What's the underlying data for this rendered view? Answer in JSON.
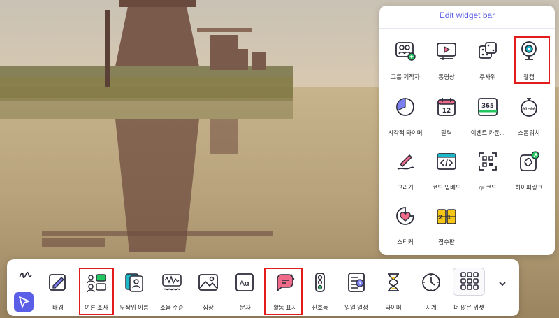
{
  "panel": {
    "title": "Edit widget bar",
    "items": [
      {
        "label": "그룹 제작자",
        "icon": "group-maker-icon"
      },
      {
        "label": "동영상",
        "icon": "video-icon"
      },
      {
        "label": "주사위",
        "icon": "dice-icon"
      },
      {
        "label": "웹캠",
        "icon": "webcam-icon"
      },
      {
        "label": "시각적 타이머",
        "icon": "visual-timer-icon"
      },
      {
        "label": "달력",
        "icon": "calendar-icon",
        "badge": "12"
      },
      {
        "label": "이벤트 카운...",
        "icon": "event-counter-icon",
        "badge": "365"
      },
      {
        "label": "스톱워치",
        "icon": "stopwatch-icon",
        "badge": "01:00"
      },
      {
        "label": "그리기",
        "icon": "draw-icon"
      },
      {
        "label": "코드 임베드",
        "icon": "code-embed-icon"
      },
      {
        "label": "qr 코드",
        "icon": "qr-code-icon"
      },
      {
        "label": "하이퍼링크",
        "icon": "hyperlink-icon"
      },
      {
        "label": "스티커",
        "icon": "sticker-icon"
      },
      {
        "label": "점수판",
        "icon": "scoreboard-icon",
        "badge": "21"
      }
    ]
  },
  "toolbar": {
    "tools": [
      {
        "label": "배경",
        "icon": "background-icon"
      },
      {
        "label": "여론 조사",
        "icon": "poll-icon"
      },
      {
        "label": "무작위 이름",
        "icon": "random-name-icon"
      },
      {
        "label": "소음 수준",
        "icon": "noise-level-icon"
      },
      {
        "label": "심상",
        "icon": "image-icon"
      },
      {
        "label": "문자",
        "icon": "text-icon",
        "glyph": "Aα"
      },
      {
        "label": "활동 표시",
        "icon": "activity-icon"
      },
      {
        "label": "신호등",
        "icon": "traffic-light-icon"
      },
      {
        "label": "일일 일정",
        "icon": "daily-schedule-icon"
      },
      {
        "label": "타이머",
        "icon": "hourglass-icon"
      },
      {
        "label": "시계",
        "icon": "clock-icon"
      },
      {
        "label": "더 많은 위젯",
        "icon": "more-widgets-icon"
      }
    ]
  },
  "colors": {
    "accent": "#5b5ee6",
    "highlight": "#e31b1b",
    "icon_stroke": "#2b2b3a",
    "icon_fill_pink": "#f06b8a",
    "icon_fill_green": "#22c55e",
    "icon_fill_teal": "#1bb8c9",
    "icon_fill_yellow": "#f5c518"
  }
}
